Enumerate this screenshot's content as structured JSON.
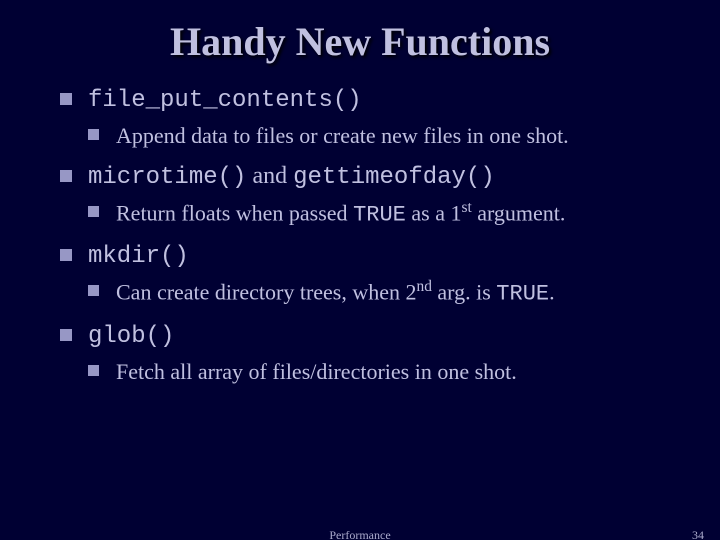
{
  "title": "Handy New Functions",
  "items": [
    {
      "func": "file_put_contents()",
      "desc_pre": "Append data to files or create new files in one shot.",
      "desc_mid1": "",
      "desc_code1": "",
      "desc_mid2": "",
      "desc_ord": "",
      "desc_ord_sup": "",
      "desc_post": ""
    },
    {
      "func": "microtime()",
      "func_conj": " and ",
      "func2": "gettimeofday()",
      "desc_pre": "Return floats when passed ",
      "desc_code1": "TRUE",
      "desc_mid1": " as a 1",
      "desc_ord_sup": "st",
      "desc_post": " argument."
    },
    {
      "func": "mkdir()",
      "desc_pre": "Can create directory trees, when 2",
      "desc_ord_sup": "nd",
      "desc_mid1": " arg. is ",
      "desc_code1": "TRUE",
      "desc_post": "."
    },
    {
      "func": "glob()",
      "desc_pre": "Fetch all array of files/directories in one shot.",
      "desc_mid1": "",
      "desc_code1": "",
      "desc_ord_sup": "",
      "desc_post": ""
    }
  ],
  "footer": {
    "center": "Performance",
    "page": "34"
  }
}
